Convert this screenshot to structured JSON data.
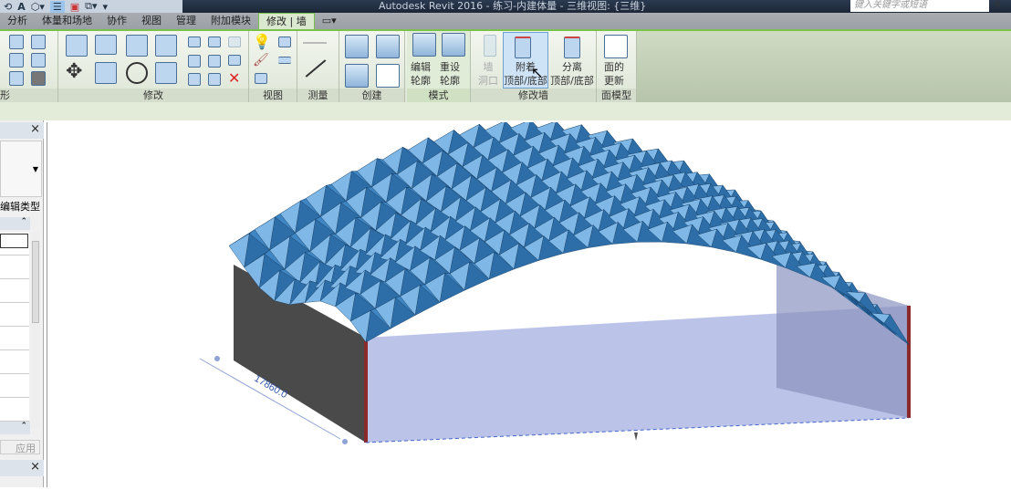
{
  "window": {
    "title": "Autodesk Revit 2016 -   练习-内建体量 - 三维视图: {三维}",
    "search_placeholder": "键入关键字或短语"
  },
  "qat": {
    "letter": "A"
  },
  "tabs": [
    "分析",
    "体量和场地",
    "协作",
    "视图",
    "管理",
    "附加模块",
    "修改 | 墙"
  ],
  "ribbon": {
    "panels": {
      "geometry": "形",
      "modify": "修改",
      "view": "视图",
      "measure": "测量",
      "create": "创建",
      "mode": "模式",
      "modify_wall": "修改墙",
      "face_model": "面模型"
    },
    "buttons": {
      "edit_profile": [
        "编辑",
        "轮廓"
      ],
      "reset_profile": [
        "重设",
        "轮廓"
      ],
      "wall_opening": [
        "墙",
        "洞口"
      ],
      "attach_top_base": [
        "附着",
        "顶部/底部"
      ],
      "detach_top_base": [
        "分离",
        "顶部/底部"
      ],
      "update_face": [
        "面的",
        "更新"
      ]
    }
  },
  "properties": {
    "edit_type": "编辑类型",
    "apply": "应用"
  },
  "viewport": {
    "dimension": "17860.0"
  },
  "colors": {
    "accent": "#7ac04d",
    "roof": "#3f86c4",
    "wall": "#4a4a4a",
    "mass": "#b4bde6"
  }
}
